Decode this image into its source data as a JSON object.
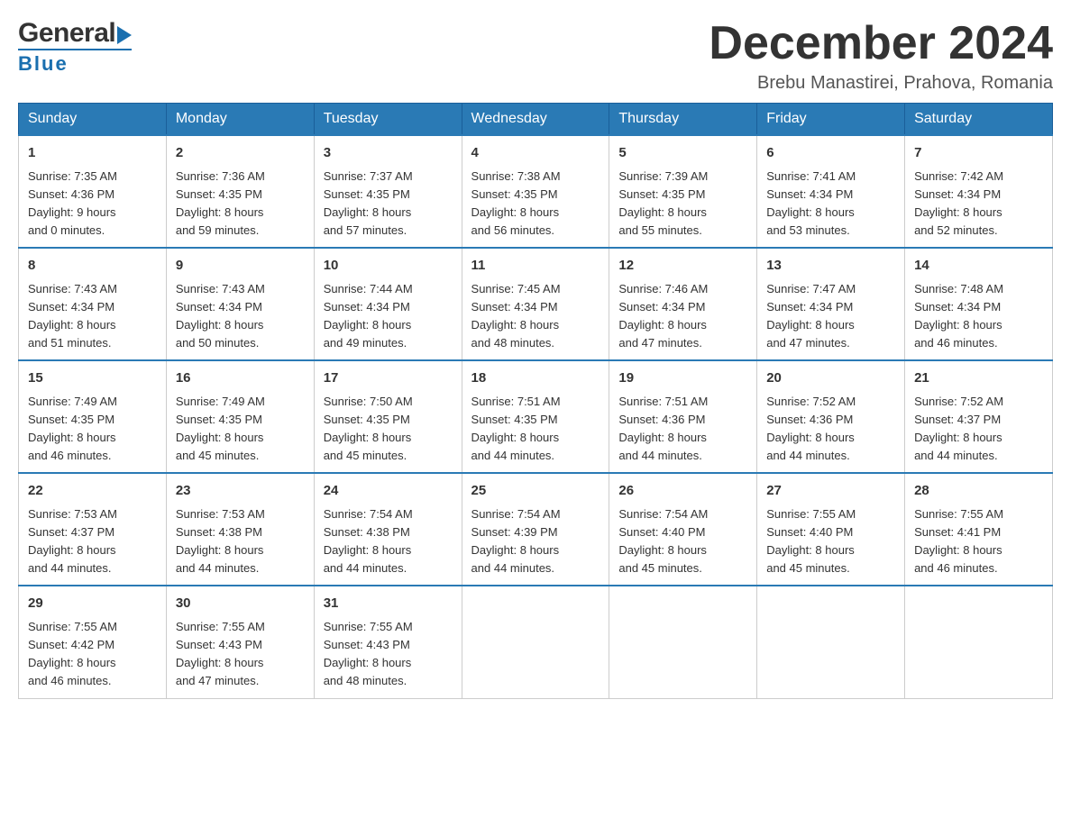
{
  "header": {
    "logo_general": "General",
    "logo_blue": "Blue",
    "month_title": "December 2024",
    "location": "Brebu Manastirei, Prahova, Romania"
  },
  "days_of_week": [
    "Sunday",
    "Monday",
    "Tuesday",
    "Wednesday",
    "Thursday",
    "Friday",
    "Saturday"
  ],
  "weeks": [
    [
      {
        "day": "1",
        "sunrise": "7:35 AM",
        "sunset": "4:36 PM",
        "daylight": "9 hours and 0 minutes."
      },
      {
        "day": "2",
        "sunrise": "7:36 AM",
        "sunset": "4:35 PM",
        "daylight": "8 hours and 59 minutes."
      },
      {
        "day": "3",
        "sunrise": "7:37 AM",
        "sunset": "4:35 PM",
        "daylight": "8 hours and 57 minutes."
      },
      {
        "day": "4",
        "sunrise": "7:38 AM",
        "sunset": "4:35 PM",
        "daylight": "8 hours and 56 minutes."
      },
      {
        "day": "5",
        "sunrise": "7:39 AM",
        "sunset": "4:35 PM",
        "daylight": "8 hours and 55 minutes."
      },
      {
        "day": "6",
        "sunrise": "7:41 AM",
        "sunset": "4:34 PM",
        "daylight": "8 hours and 53 minutes."
      },
      {
        "day": "7",
        "sunrise": "7:42 AM",
        "sunset": "4:34 PM",
        "daylight": "8 hours and 52 minutes."
      }
    ],
    [
      {
        "day": "8",
        "sunrise": "7:43 AM",
        "sunset": "4:34 PM",
        "daylight": "8 hours and 51 minutes."
      },
      {
        "day": "9",
        "sunrise": "7:43 AM",
        "sunset": "4:34 PM",
        "daylight": "8 hours and 50 minutes."
      },
      {
        "day": "10",
        "sunrise": "7:44 AM",
        "sunset": "4:34 PM",
        "daylight": "8 hours and 49 minutes."
      },
      {
        "day": "11",
        "sunrise": "7:45 AM",
        "sunset": "4:34 PM",
        "daylight": "8 hours and 48 minutes."
      },
      {
        "day": "12",
        "sunrise": "7:46 AM",
        "sunset": "4:34 PM",
        "daylight": "8 hours and 47 minutes."
      },
      {
        "day": "13",
        "sunrise": "7:47 AM",
        "sunset": "4:34 PM",
        "daylight": "8 hours and 47 minutes."
      },
      {
        "day": "14",
        "sunrise": "7:48 AM",
        "sunset": "4:34 PM",
        "daylight": "8 hours and 46 minutes."
      }
    ],
    [
      {
        "day": "15",
        "sunrise": "7:49 AM",
        "sunset": "4:35 PM",
        "daylight": "8 hours and 46 minutes."
      },
      {
        "day": "16",
        "sunrise": "7:49 AM",
        "sunset": "4:35 PM",
        "daylight": "8 hours and 45 minutes."
      },
      {
        "day": "17",
        "sunrise": "7:50 AM",
        "sunset": "4:35 PM",
        "daylight": "8 hours and 45 minutes."
      },
      {
        "day": "18",
        "sunrise": "7:51 AM",
        "sunset": "4:35 PM",
        "daylight": "8 hours and 44 minutes."
      },
      {
        "day": "19",
        "sunrise": "7:51 AM",
        "sunset": "4:36 PM",
        "daylight": "8 hours and 44 minutes."
      },
      {
        "day": "20",
        "sunrise": "7:52 AM",
        "sunset": "4:36 PM",
        "daylight": "8 hours and 44 minutes."
      },
      {
        "day": "21",
        "sunrise": "7:52 AM",
        "sunset": "4:37 PM",
        "daylight": "8 hours and 44 minutes."
      }
    ],
    [
      {
        "day": "22",
        "sunrise": "7:53 AM",
        "sunset": "4:37 PM",
        "daylight": "8 hours and 44 minutes."
      },
      {
        "day": "23",
        "sunrise": "7:53 AM",
        "sunset": "4:38 PM",
        "daylight": "8 hours and 44 minutes."
      },
      {
        "day": "24",
        "sunrise": "7:54 AM",
        "sunset": "4:38 PM",
        "daylight": "8 hours and 44 minutes."
      },
      {
        "day": "25",
        "sunrise": "7:54 AM",
        "sunset": "4:39 PM",
        "daylight": "8 hours and 44 minutes."
      },
      {
        "day": "26",
        "sunrise": "7:54 AM",
        "sunset": "4:40 PM",
        "daylight": "8 hours and 45 minutes."
      },
      {
        "day": "27",
        "sunrise": "7:55 AM",
        "sunset": "4:40 PM",
        "daylight": "8 hours and 45 minutes."
      },
      {
        "day": "28",
        "sunrise": "7:55 AM",
        "sunset": "4:41 PM",
        "daylight": "8 hours and 46 minutes."
      }
    ],
    [
      {
        "day": "29",
        "sunrise": "7:55 AM",
        "sunset": "4:42 PM",
        "daylight": "8 hours and 46 minutes."
      },
      {
        "day": "30",
        "sunrise": "7:55 AM",
        "sunset": "4:43 PM",
        "daylight": "8 hours and 47 minutes."
      },
      {
        "day": "31",
        "sunrise": "7:55 AM",
        "sunset": "4:43 PM",
        "daylight": "8 hours and 48 minutes."
      },
      null,
      null,
      null,
      null
    ]
  ],
  "labels": {
    "sunrise": "Sunrise:",
    "sunset": "Sunset:",
    "daylight": "Daylight:"
  }
}
